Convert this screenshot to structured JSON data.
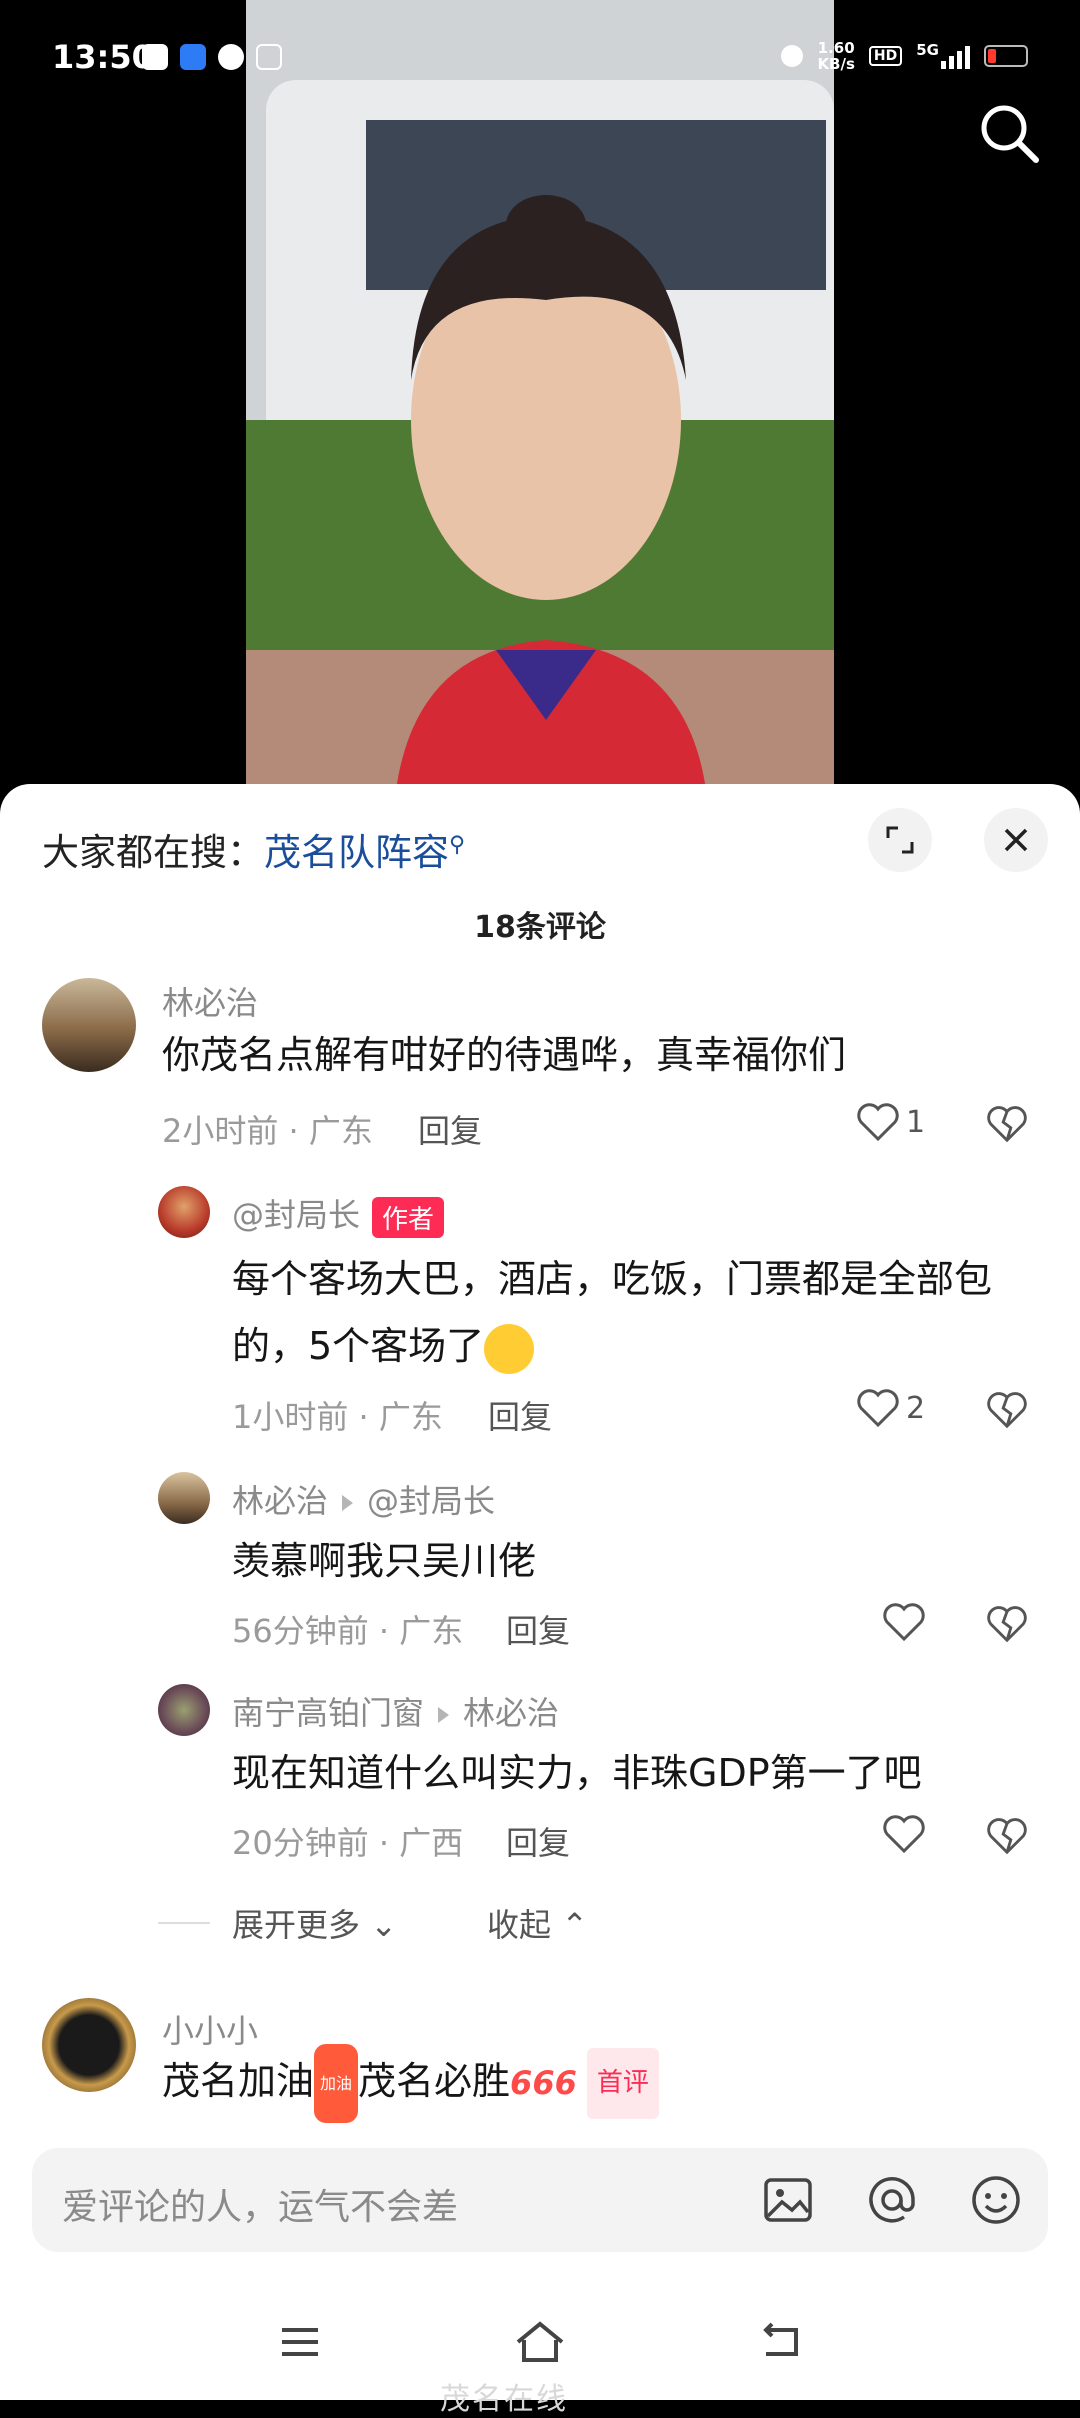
{
  "status_bar": {
    "time": "13:50",
    "net_speed_value": "1.60",
    "net_speed_unit": "KB/s",
    "hd": "HD",
    "network": "5G",
    "battery_color": "#ff3b30"
  },
  "hot_search": {
    "prefix": "大家都在搜：",
    "keyword": "茂名队阵容"
  },
  "comments_header": {
    "count_label": "18条评论"
  },
  "comments": [
    {
      "name": "林必治",
      "text": "你茂名点解有咁好的待遇哗，真幸福你们",
      "meta": "2小时前 · 广东",
      "reply_label": "回复",
      "likes": "1"
    },
    {
      "name": "@封局长",
      "badge": "作者",
      "text_line1": "每个客场大巴，酒店，吃饭，门票都是全部包",
      "text_line2": "的，5个客场了",
      "meta": "1小时前 · 广东",
      "reply_label": "回复",
      "likes": "2"
    },
    {
      "name": "林必治",
      "reply_to": "@封局长",
      "text": "羡慕啊我只吴川佬",
      "meta": "56分钟前 · 广东",
      "reply_label": "回复"
    },
    {
      "name": "南宁高铂门窗",
      "reply_to": "林必治",
      "text": "现在知道什么叫实力，非珠GDP第一了吧",
      "meta": "20分钟前 · 广西",
      "reply_label": "回复"
    },
    {
      "name": "小小小",
      "text_part1": "茂名加油",
      "sticker_text": "加油",
      "text_part2": "茂名必胜",
      "emoji_666": "666",
      "badge": "首评"
    }
  ],
  "expand": {
    "more_label": "展开更多",
    "collapse_label": "收起"
  },
  "input": {
    "placeholder": "爱评论的人，运气不会差"
  },
  "watermark": "茂名在线"
}
